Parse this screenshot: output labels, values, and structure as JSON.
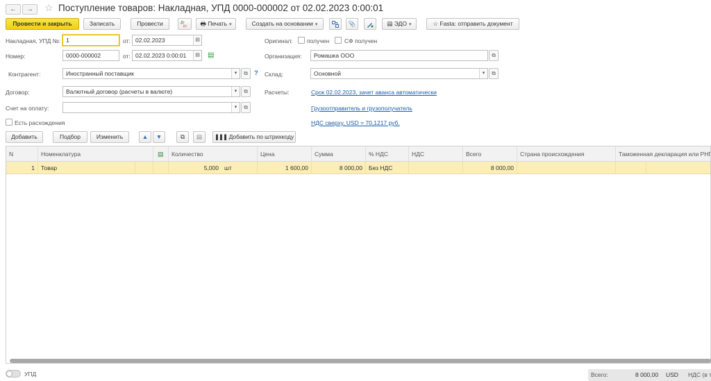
{
  "window": {
    "title": "Поступление товаров: Накладная, УПД 0000-000002 от 02.02.2023 0:00:01",
    "back_icon": "arrow-left-icon",
    "forward_icon": "arrow-right-icon",
    "favorite_icon": "star-icon"
  },
  "toolbar": {
    "post_and_close": "Провести и закрыть",
    "save": "Записать",
    "post": "Провести",
    "print": "Печать",
    "create_based_on": "Создать на основании",
    "edo": "ЭДО",
    "fasta": "Fasta: отправить документ"
  },
  "form": {
    "invoice_label": "Накладная, УПД №:",
    "invoice_number": "1",
    "date_from_label": "от:",
    "invoice_date": "02.02.2023",
    "original_label": "Оригинал:",
    "received_label": "получен",
    "sf_received_label": "СФ получен",
    "number_label": "Номер:",
    "number_value": "0000-000002",
    "number_date_label": "от:",
    "number_date": "02.02.2023  0:00:01",
    "organization_label": "Организация:",
    "organization_value": "Ромашка ООО",
    "counterparty_label": "Контрагент:",
    "counterparty_value": "Иностранный поставщик",
    "help_mark": "?",
    "warehouse_label": "Склад:",
    "warehouse_value": "Основной",
    "contract_label": "Договор:",
    "contract_value": "Валютный договор (расчеты в валюте)",
    "settlements_label": "Расчеты:",
    "settlements_link": "Срок 02.02.2023, зачет аванса автоматически",
    "payment_account_label": "Счет на оплату:",
    "payment_account_value": "",
    "shipper_link": "Грузоотправитель и грузополучатель",
    "discrepancies_label": "Есть расхождения",
    "vat_link": "НДС сверху, USD = 70,1217 руб."
  },
  "table_toolbar": {
    "add": "Добавить",
    "pick": "Подбор",
    "change": "Изменить",
    "barcode": "Добавить по штрихкоду"
  },
  "table": {
    "columns": [
      "N",
      "Номенклатура",
      "Количество",
      "Цена",
      "Сумма",
      "% НДС",
      "НДС",
      "Всего",
      "Страна происхождения",
      "Таможенная декларация или РНПТ"
    ],
    "rows": [
      {
        "n": "1",
        "item": "Товар",
        "qty": "5,000",
        "unit": "шт",
        "price": "1 600,00",
        "sum": "8 000,00",
        "vat_rate": "Без НДС",
        "vat": "",
        "total": "8 000,00",
        "country": "",
        "customs": ""
      }
    ]
  },
  "footer": {
    "upd_label": "УПД",
    "total_label": "Всего:",
    "total_value": "8 000,00",
    "currency": "USD",
    "vat_label": "НДС (в т.ч.)"
  },
  "colors": {
    "primary_button": "#f2cf15",
    "selected_row": "#fbeeb9",
    "link": "#1c5ca8"
  }
}
